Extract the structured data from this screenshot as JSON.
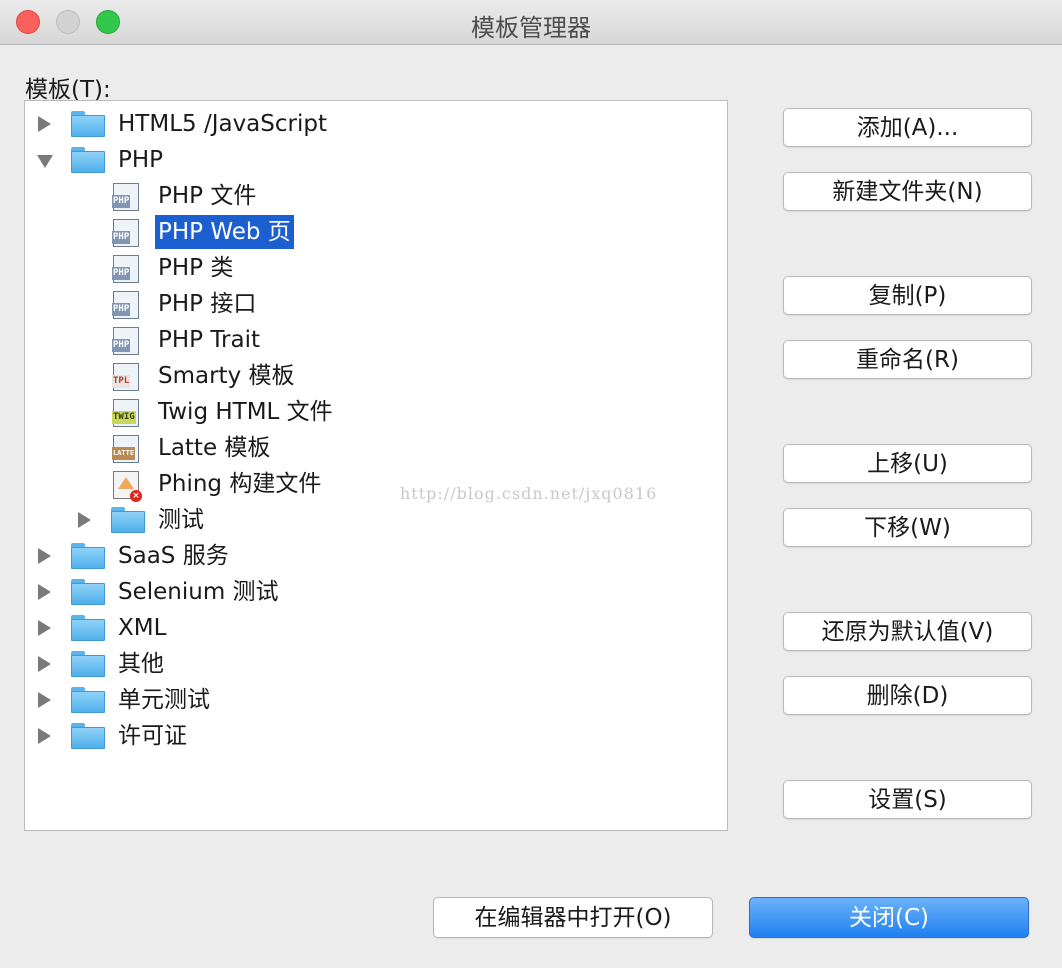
{
  "window": {
    "title": "模板管理器"
  },
  "tree": {
    "label": "模板(T):",
    "items": [
      {
        "label": "HTML5 /JavaScript"
      },
      {
        "label": "PHP"
      },
      {
        "label": "PHP 文件"
      },
      {
        "label": "PHP Web 页"
      },
      {
        "label": "PHP 类"
      },
      {
        "label": "PHP 接口"
      },
      {
        "label": "PHP Trait"
      },
      {
        "label": "Smarty 模板"
      },
      {
        "label": "Twig HTML 文件"
      },
      {
        "label": "Latte 模板"
      },
      {
        "label": "Phing 构建文件"
      },
      {
        "label": "测试"
      },
      {
        "label": "SaaS 服务"
      },
      {
        "label": "Selenium 测试"
      },
      {
        "label": "XML"
      },
      {
        "label": "其他"
      },
      {
        "label": "单元测试"
      },
      {
        "label": "许可证"
      }
    ],
    "selected_item": "PHP Web 页",
    "icons": {
      "php": "PHP",
      "tpl": "TPL",
      "twig": "TWIG",
      "latte": "LATTE"
    }
  },
  "watermark": "http://blog.csdn.net/jxq0816",
  "buttons": {
    "add": "添加(A)...",
    "new_folder": "新建文件夹(N)",
    "copy": "复制(P)",
    "rename": "重命名(R)",
    "move_up": "上移(U)",
    "move_down": "下移(W)",
    "restore_default": "还原为默认值(V)",
    "delete": "删除(D)",
    "settings": "设置(S)",
    "open_in_editor": "在编辑器中打开(O)",
    "close": "关闭(C)"
  },
  "colors": {
    "selection": "#1b5fd0",
    "primary_button": "#1f7ff0"
  }
}
